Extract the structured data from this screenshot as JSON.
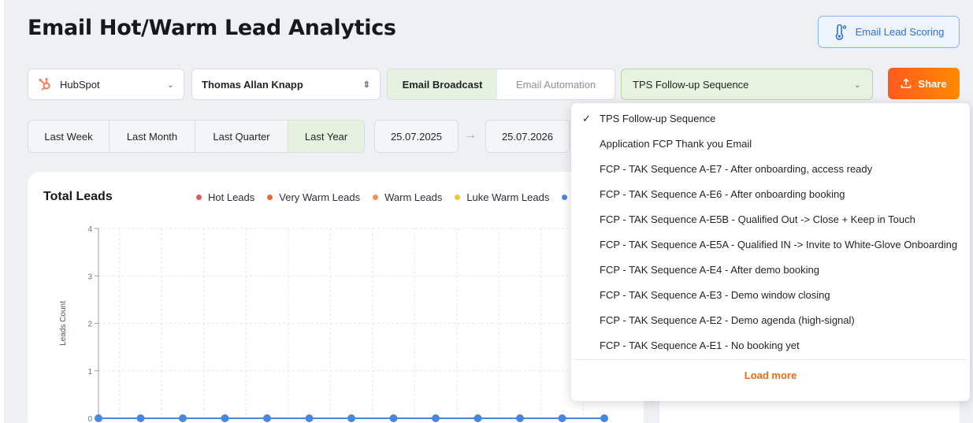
{
  "header": {
    "title": "Email Hot/Warm Lead Analytics",
    "scoring_button": "Email Lead Scoring"
  },
  "filters": {
    "crm": "HubSpot",
    "user": "Thomas Allan Knapp",
    "channel_tabs": [
      "Email Broadcast",
      "Email Automation"
    ],
    "sequence": "TPS Follow-up Sequence",
    "share_label": "Share",
    "ranges": [
      "Last Week",
      "Last Month",
      "Last Quarter",
      "Last Year"
    ],
    "date_from": "25.07.2025",
    "date_to": "25.07.2026"
  },
  "dropdown": {
    "items": [
      "TPS Follow-up Sequence",
      "Application FCP Thank you Email",
      "FCP - TAK Sequence A-E7 - After onboarding, access ready",
      "FCP - TAK Sequence A-E6 - After onboarding booking",
      "FCP - TAK Sequence A-E5B - Qualified Out -> Close + Keep in Touch",
      "FCP - TAK Sequence A-E5A - Qualified IN -> Invite to White-Glove Onboarding",
      "FCP - TAK Sequence A-E4 - After demo booking",
      "FCP - TAK Sequence A-E3 - Demo window closing",
      "FCP - TAK Sequence A-E2 - Demo agenda (high-signal)",
      "FCP - TAK Sequence A-E1 - No booking yet"
    ],
    "load_more": "Load more"
  },
  "colors": {
    "accent": "#ff6a13",
    "hot": "#e05a5a",
    "very_warm": "#f0643a",
    "warm": "#f4915a",
    "luke_warm": "#f6c23e",
    "point": "#4a86d9"
  },
  "chart_data": {
    "type": "line",
    "title": "Total Leads",
    "ylabel": "Leads Count",
    "ylim": [
      0,
      4
    ],
    "y_ticks": [
      "0",
      "1",
      "2",
      "3",
      "4"
    ],
    "legend": [
      "Hot Leads",
      "Very Warm Leads",
      "Warm Leads",
      "Luke Warm Leads"
    ],
    "series": [
      {
        "values": [
          0,
          0,
          0,
          0,
          0,
          0,
          0,
          0,
          0,
          0,
          0,
          0,
          0
        ]
      }
    ]
  }
}
